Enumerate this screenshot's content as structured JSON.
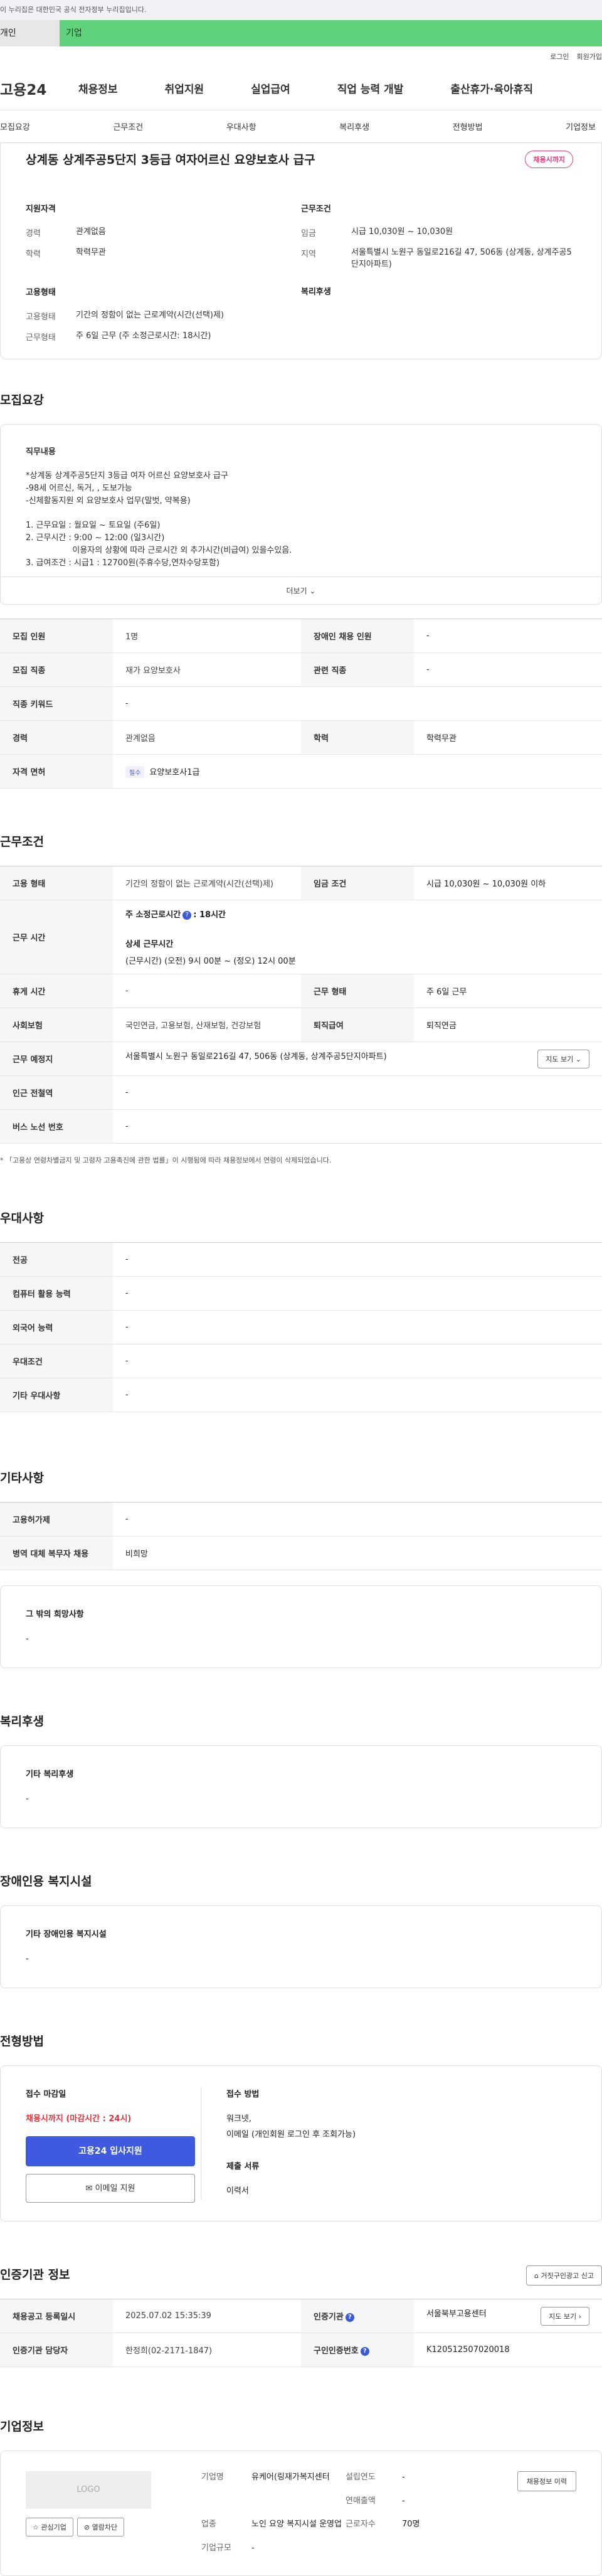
{
  "banner": {
    "text": "이 누리집은 대한민국 공식 전자정부 누리집입니다."
  },
  "tabs": {
    "personal": "개인",
    "company": "기업"
  },
  "util": {
    "login": "로그인",
    "join": "회원가입"
  },
  "logo": "고용24",
  "gnb": [
    "채용정보",
    "취업지원",
    "실업급여",
    "직업 능력 개발",
    "출산휴가·육아휴직"
  ],
  "subnav": [
    "모집요강",
    "근무조건",
    "우대사항",
    "복리후생",
    "전형방법",
    "기업정보"
  ],
  "job": {
    "title": "상계동 상계주공5단지 3등급 여자어르신 요양보호사 급구",
    "status": "채용시까지",
    "qualification_head": "지원자격",
    "experience_label": "경력",
    "experience": "관계없음",
    "education_label": "학력",
    "education": "학력무관",
    "employment_head": "고용형태",
    "employment_label": "고용형태",
    "employment": "기간의 정함이 없는 근로계약(시간(선택)제)",
    "workform_label": "근무형태",
    "workform": "주 6일 근무 (주 소정근로시간: 18시간)",
    "conditions_head": "근무조건",
    "wage_label": "임금",
    "wage": "시급 10,030원 ~ 10,030원",
    "region_label": "지역",
    "region": "서울특별시 노원구 동일로216길 47, 506동 (상계동, 상계주공5단지아파트)",
    "welfare_head": "복리후생"
  },
  "recruit": {
    "section": "모집요강",
    "duty_head": "직무내용",
    "duty_lines": [
      "*상계동 상계주공5단지 3등급  여자 어르신 요양보호사 급구",
      "-98세 어르신, 독거, , 도보가능",
      "-신체활동지원 외 요양보호사 업무(말벗, 약복용)",
      "",
      "1. 근무요일 : 월요일 ~ 토요일 (주6일)",
      "2. 근무시간 : 9:00 ~ 12:00 (일3시간)",
      "                  이용자의 상황에 따라 근로시간 외 추가시간(비급여) 있을수있음.",
      "3. 급여조건 : 시급1 : 12700원(주휴수당,연차수당포함)"
    ],
    "more": "더보기",
    "rows": [
      [
        "모집 인원",
        "1명",
        "장애인 채용 인원",
        "-"
      ],
      [
        "모집 직종",
        "재가 요양보호사",
        "관련 직종",
        "-"
      ],
      [
        "직종 키워드",
        "-",
        "",
        ""
      ],
      [
        "경력",
        "관계없음",
        "학력",
        "학력무관"
      ]
    ],
    "license_label": "자격 면허",
    "license_tag": "필수",
    "license": "요양보호사1급"
  },
  "work": {
    "section": "근무조건",
    "emp_label": "고용 형태",
    "emp": "기간의 정함이 없는 근로계약(시간(선택)제)",
    "wage_label": "임금 조건",
    "wage": "시급 10,030원 ~ 10,030원 이하",
    "time_label": "근무 시간",
    "weekly": "주 소정근로시간",
    "weekly_val": ": 18시간",
    "detail_head": "상세 근무시간",
    "detail": "(근무시간) (오전) 9시 00분 ~ (정오) 12시 00분",
    "rest_label": "휴게 시간",
    "rest": "-",
    "form_label": "근무 형태",
    "form": "주 6일 근무",
    "ins_label": "사회보험",
    "ins": "국민연금, 고용보험, 산재보험, 건강보험",
    "sev_label": "퇴직급여",
    "sev": "퇴직연금",
    "place_label": "근무 예정지",
    "place": "서울특별시 노원구 동일로216길 47, 506동 (상계동, 상계주공5단지아파트)",
    "map": "지도 보기",
    "subway_label": "인근 전철역",
    "subway": "-",
    "bus_label": "버스 노선 번호",
    "bus": "-",
    "note": "* 「고용상 연령차별금지 및 고령자 고용촉진에 관한 법률」이 시행됨에 따라 채용정보에서 연령이 삭제되었습니다."
  },
  "pref": {
    "section": "우대사항",
    "rows": [
      [
        "전공",
        "-"
      ],
      [
        "컴퓨터 활용 능력",
        "-"
      ],
      [
        "외국어 능력",
        "-"
      ],
      [
        "우대조건",
        "-"
      ],
      [
        "기타 우대사항",
        "-"
      ]
    ]
  },
  "etc": {
    "section": "기타사항",
    "rows": [
      [
        "고용허가제",
        "-"
      ],
      [
        "병역 대체 복무자 채용",
        "비희망"
      ]
    ],
    "other_head": "그 밖의 희망사항",
    "other": "-"
  },
  "welfare": {
    "section": "복리후생",
    "head": "기타 복리후생",
    "value": "-"
  },
  "disabled": {
    "section": "장애인용 복지시설",
    "head": "기타 장애인용 복지시설",
    "value": "-"
  },
  "method": {
    "section": "전형방법",
    "deadline_head": "접수 마감일",
    "deadline": "채용시까지 (마감시간 : 24시)",
    "apply": "고용24 입사지원",
    "email": "이메일 지원",
    "how_head": "접수 방법",
    "how1": "워크넷,",
    "how2": "이메일 (개인회원 로그인 후 조회가능)",
    "docs_head": "제출 서류",
    "docs": "이력서"
  },
  "cert": {
    "section": "인증기관 정보",
    "report": "거짓구인광고 신고",
    "reg_label": "채용공고 등록일시",
    "reg": "2025.07.02 15:35:39",
    "org_label": "인증기관",
    "org": "서울북부고용센터",
    "map": "지도 보기",
    "mgr_label": "인증기관 담당자",
    "mgr": "한정희(02-2171-1847)",
    "no_label": "구인인증번호",
    "no": "K120512507020018"
  },
  "company": {
    "section": "기업정보",
    "logo": "LOGO",
    "interest": "관심기업",
    "block": "열람차단",
    "name_label": "기업명",
    "name": "유케어(링재가복지센터",
    "founded_label": "설립연도",
    "founded": "-",
    "sales_label": "연매출액",
    "sales": "-",
    "biz_label": "업종",
    "biz": "노인 요양 복지시설 운영업",
    "staff_label": "근로자수",
    "staff": "70명",
    "size_label": "기업규모",
    "size": "-",
    "history": "채용정보 이력"
  }
}
